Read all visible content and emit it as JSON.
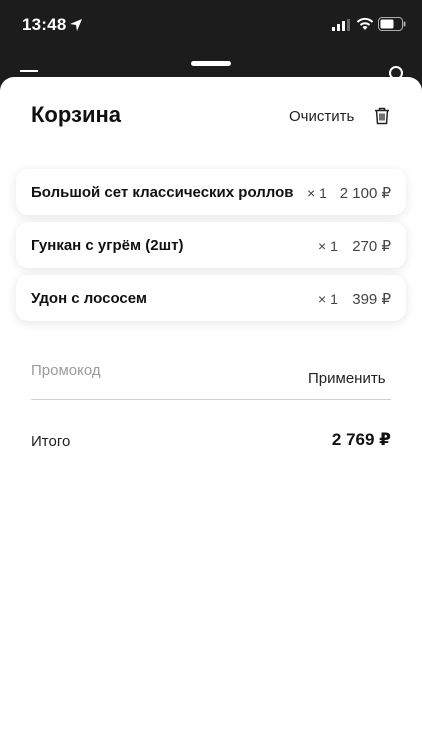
{
  "status_bar": {
    "time": "13:48",
    "icons": [
      "location-arrow-icon",
      "cellular-signal-icon",
      "wifi-icon",
      "battery-icon"
    ]
  },
  "cart": {
    "title": "Корзина",
    "clear_label": "Очистить",
    "items": [
      {
        "name": "Большой сет классических роллов",
        "qty": "× 1",
        "price": "2 100 ₽"
      },
      {
        "name": "Гункан с угрём (2шт)",
        "qty": "× 1",
        "price": "270 ₽"
      },
      {
        "name": "Удон с лососем",
        "qty": "× 1",
        "price": "399 ₽"
      }
    ],
    "promo": {
      "placeholder": "Промокод",
      "apply_label": "Применить"
    },
    "total": {
      "label": "Итого",
      "value": "2 769 ₽"
    }
  },
  "colors": {
    "background": "#1c1c1c",
    "sheet": "#ffffff",
    "text": "#111111",
    "muted": "#9a9a9a"
  }
}
